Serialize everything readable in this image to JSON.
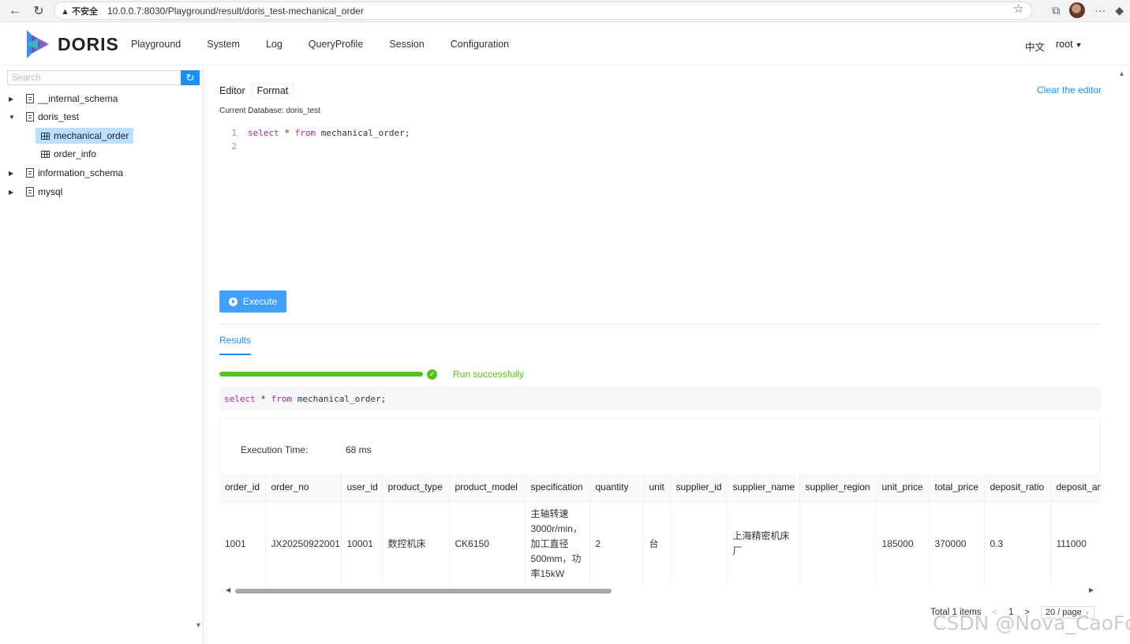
{
  "browser": {
    "security_warning": "▲ 不安全",
    "url": "10.0.0.7:8030/Playground/result/doris_test-mechanical_order"
  },
  "header": {
    "brand": "DORIS",
    "menu": [
      "Playground",
      "System",
      "Log",
      "QueryProfile",
      "Session",
      "Configuration"
    ],
    "language": "中文",
    "user": "root"
  },
  "sidebar": {
    "search_placeholder": "Search",
    "databases": [
      {
        "name": "__internal_schema",
        "expanded": false
      },
      {
        "name": "doris_test",
        "expanded": true,
        "tables": [
          {
            "name": "mechanical_order",
            "selected": true
          },
          {
            "name": "order_info",
            "selected": false
          }
        ]
      },
      {
        "name": "information_schema",
        "expanded": false
      },
      {
        "name": "mysql",
        "expanded": false
      }
    ]
  },
  "editor": {
    "tab_editor": "Editor",
    "tab_format": "Format",
    "clear_label": "Clear the editor",
    "current_database_label": "Current Database: doris_test",
    "line1_no": "1",
    "line2_no": "2",
    "kw_select": "select",
    "kw_from": "from",
    "code_star": " * ",
    "code_table": " mechanical_order;",
    "execute_label": "Execute"
  },
  "results": {
    "tab_label": "Results",
    "progress_percent": 100,
    "status_text": "Run successfully",
    "sql_select": "select",
    "sql_star": " * ",
    "sql_from": "from",
    "sql_table": " mechanical_order;",
    "exec_time_label": "Execution Time:",
    "exec_time_value": "68 ms",
    "columns": [
      "order_id",
      "order_no",
      "user_id",
      "product_type",
      "product_model",
      "specification",
      "quantity",
      "unit",
      "supplier_id",
      "supplier_name",
      "supplier_region",
      "unit_price",
      "total_price",
      "deposit_ratio",
      "deposit_amo"
    ],
    "rows": [
      [
        "1001",
        "JX20250922001",
        "10001",
        "数控机床",
        "CK6150",
        "主轴转速3000r/min，加工直径500mm，功率15kW",
        "2",
        "台",
        "",
        "上海精密机床厂",
        "",
        "185000",
        "370000",
        "0.3",
        "111000"
      ]
    ]
  },
  "pagination": {
    "total": "Total 1 items",
    "prev": "<",
    "page": "1",
    "next": ">",
    "page_size": "20 / page"
  },
  "watermark": "CSDN @Nova_CaoFc",
  "colors": {
    "accent": "#1890ff",
    "success": "#52c41a",
    "selected_bg": "#bae0ff"
  }
}
